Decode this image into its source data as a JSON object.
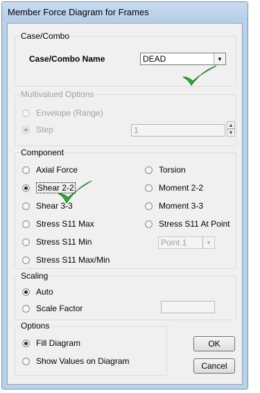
{
  "window": {
    "title": "Member Force Diagram for Frames"
  },
  "case_combo": {
    "legend": "Case/Combo",
    "name_label": "Case/Combo Name",
    "selected": "DEAD"
  },
  "multivalued": {
    "legend": "Multivalued Options",
    "envelope_label": "Envelope (Range)",
    "step_label": "Step",
    "step_value": "1"
  },
  "component": {
    "legend": "Component",
    "options": {
      "axial_force": "Axial Force",
      "shear_2_2": "Shear 2-2",
      "shear_3_3": "Shear 3-3",
      "stress_s11_max": "Stress S11 Max",
      "stress_s11_min": "Stress S11 Min",
      "stress_s11_maxmin": "Stress S11 Max/Min",
      "torsion": "Torsion",
      "moment_2_2": "Moment 2-2",
      "moment_3_3": "Moment 3-3",
      "stress_s11_at_point": "Stress S11 At Point"
    },
    "selected": "shear_2_2",
    "point_value": "Point 1"
  },
  "scaling": {
    "legend": "Scaling",
    "auto_label": "Auto",
    "scale_factor_label": "Scale Factor",
    "scale_factor_value": ""
  },
  "options": {
    "legend": "Options",
    "fill_label": "Fill Diagram",
    "show_values_label": "Show Values on Diagram"
  },
  "buttons": {
    "ok": "OK",
    "cancel": "Cancel"
  },
  "annotations": {
    "checkmark_color": "#2eaa3a",
    "accent": "#1a2f4d"
  }
}
